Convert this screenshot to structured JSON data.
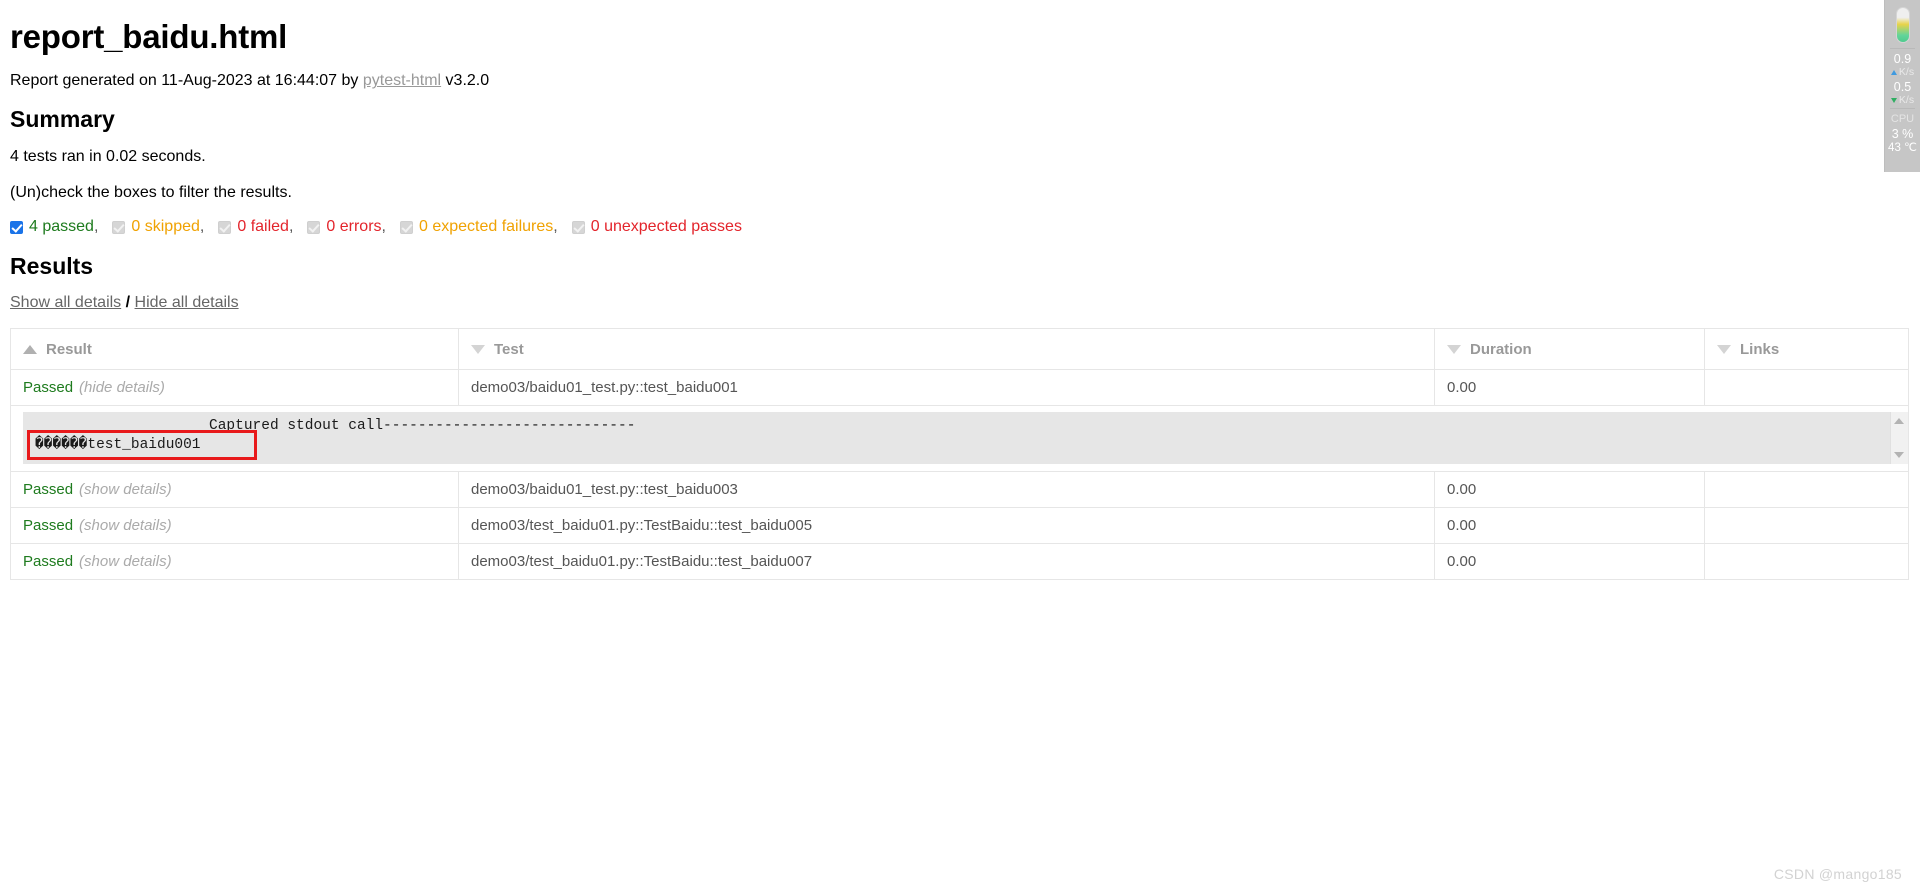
{
  "report": {
    "title": "report_baidu.html",
    "generated_prefix": "Report generated on 11-Aug-2023 at 16:44:07 by ",
    "generator_link": "pytest-html",
    "generator_version": " v3.2.0"
  },
  "summary": {
    "heading": "Summary",
    "ran_line": "4 tests ran in 0.02 seconds.",
    "filter_hint": "(Un)check the boxes to filter the results.",
    "filters": [
      {
        "label": "4 passed",
        "color": "#1e7b1e",
        "checked": true,
        "separator": ","
      },
      {
        "label": "0 skipped",
        "color": "#f0a202",
        "checked": false,
        "separator": ","
      },
      {
        "label": "0 failed",
        "color": "#e3242b",
        "checked": false,
        "separator": ","
      },
      {
        "label": "0 errors",
        "color": "#e3242b",
        "checked": false,
        "separator": ","
      },
      {
        "label": "0 expected failures",
        "color": "#f0a202",
        "checked": false,
        "separator": ","
      },
      {
        "label": "0 unexpected passes",
        "color": "#e3242b",
        "checked": false,
        "separator": ""
      }
    ]
  },
  "results": {
    "heading": "Results",
    "show_all": "Show all details",
    "slash": "/",
    "hide_all": "Hide all details",
    "columns": [
      {
        "label": "Result",
        "sort": "up"
      },
      {
        "label": "Test",
        "sort": "down"
      },
      {
        "label": "Duration",
        "sort": "down"
      },
      {
        "label": "Links",
        "sort": "down"
      }
    ],
    "rows": [
      {
        "result": "Passed",
        "toggle": "(hide details)",
        "test": "demo03/baidu01_test.py::test_baidu001",
        "duration": "0.00",
        "links": "",
        "expanded": true,
        "log_line1": "                    Captured stdout call-----------------------------",
        "log_line2": "\u0001\u0001\u0001\u0001\u0001\u0001test_baidu001"
      },
      {
        "result": "Passed",
        "toggle": "(show details)",
        "test": "demo03/baidu01_test.py::test_baidu003",
        "duration": "0.00",
        "links": "",
        "expanded": false
      },
      {
        "result": "Passed",
        "toggle": "(show details)",
        "test": "demo03/test_baidu01.py::TestBaidu::test_baidu005",
        "duration": "0.00",
        "links": "",
        "expanded": false
      },
      {
        "result": "Passed",
        "toggle": "(show details)",
        "test": "demo03/test_baidu01.py::TestBaidu::test_baidu007",
        "duration": "0.00",
        "links": "",
        "expanded": false
      }
    ]
  },
  "monitor": {
    "upload_value": "0.9",
    "upload_unit": "K/s",
    "download_value": "0.5",
    "download_unit": "K/s",
    "cpu_label": "CPU",
    "cpu_value": "3 %",
    "cpu_temp": "43 ℃"
  },
  "watermark": "CSDN @mango185"
}
